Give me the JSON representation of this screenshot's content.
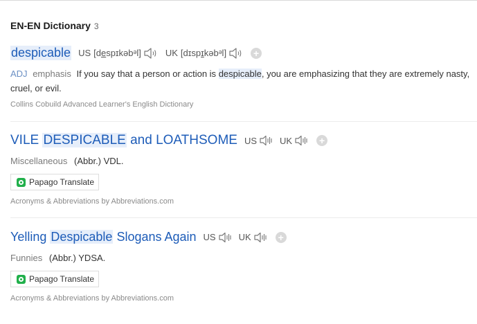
{
  "section": {
    "title": "EN-EN Dictionary",
    "count": "3"
  },
  "entry1": {
    "headword": "despicable",
    "us_label": "US",
    "us_ipa_open": "[d",
    "us_ipa_ul": "e",
    "us_ipa_rest": "spɪkəbᵊl]",
    "uk_label": "UK",
    "uk_ipa_open": "[dɪsp",
    "uk_ipa_ul": "ɪ",
    "uk_ipa_rest": "kəbᵊl]",
    "pos": "ADJ",
    "grammar": "emphasis",
    "def_before": "If you say that a person or action is ",
    "def_highlight": "despicable",
    "def_after": ", you are emphasizing that they are extremely nasty, cruel, or evil.",
    "source": "Collins Cobuild Advanced Learner's English Dictionary"
  },
  "entry2": {
    "head_pre": "VILE ",
    "head_highlight": "DESPICABLE",
    "head_post": " and LOATHSOME",
    "us_label": "US",
    "uk_label": "UK",
    "category": "Miscellaneous",
    "abbr": "(Abbr.) VDL.",
    "button_label": "Papago Translate",
    "source": "Acronyms & Abbreviations by Abbreviations.com"
  },
  "entry3": {
    "head_pre": "Yelling ",
    "head_highlight": "Despicable",
    "head_post": " Slogans Again",
    "us_label": "US",
    "uk_label": "UK",
    "category": "Funnies",
    "abbr": "(Abbr.) YDSA.",
    "button_label": "Papago Translate",
    "source": "Acronyms & Abbreviations by Abbreviations.com"
  },
  "colors": {
    "headword_blue": "#1d5cb8",
    "highlight_bg": "#e6eefa",
    "papago_green": "#21b04b"
  },
  "icons": [
    "speaker-icon",
    "plus-circle-icon",
    "papago-icon"
  ]
}
